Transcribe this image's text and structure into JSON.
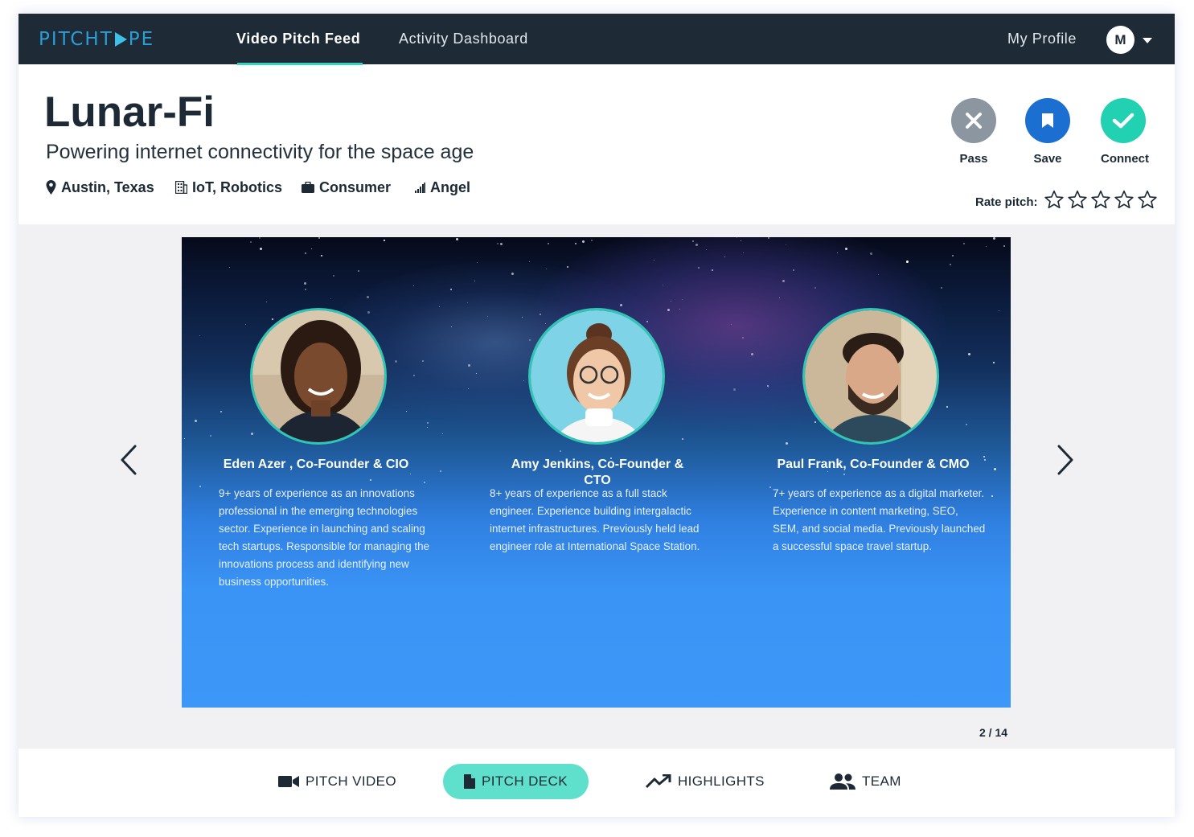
{
  "nav": {
    "brand": "PITCHTYPE",
    "brand_left": "PITCHT",
    "brand_right": "PE",
    "links": [
      "Video Pitch Feed",
      "Activity Dashboard"
    ],
    "profile_label": "My Profile",
    "avatar_initial": "M"
  },
  "company": {
    "name": "Lunar-Fi",
    "tagline": "Powering internet connectivity for the space age",
    "location": "Austin, Texas",
    "industry": "IoT, Robotics",
    "market": "Consumer",
    "stage": "Angel"
  },
  "actions": {
    "pass_label": "Pass",
    "save_label": "Save",
    "connect_label": "Connect",
    "rate_label": "Rate pitch:",
    "rating": 0,
    "max_rating": 5
  },
  "slide": {
    "people": [
      {
        "name": "Eden Azer , Co-Founder & CIO",
        "bio": "9+ years of experience as an innovations professional in the emerging technologies sector. Experience in launching and scaling tech startups. Responsible for managing the innovations process and identifying new business opportunities."
      },
      {
        "name": "Amy Jenkins, Co-Founder & CTO",
        "bio": "8+ years of experience as a full stack engineer. Experience building intergalactic internet infrastructures. Previously held lead engineer role at International Space Station."
      },
      {
        "name": "Paul Frank, Co-Founder & CMO",
        "bio": "7+ years of experience as a digital marketer. Experience in content marketing, SEO, SEM, and social media. Previously launched a successful space travel startup."
      }
    ],
    "counter": "2 / 14"
  },
  "tabs": [
    "PITCH VIDEO",
    "PITCH DECK",
    "HIGHLIGHTS",
    "TEAM"
  ],
  "colors": {
    "nav_bg": "#1e2a36",
    "accent": "#35d3c0",
    "pass": "#8c96a1",
    "save": "#1a6fd1",
    "connect": "#22d1b2"
  }
}
